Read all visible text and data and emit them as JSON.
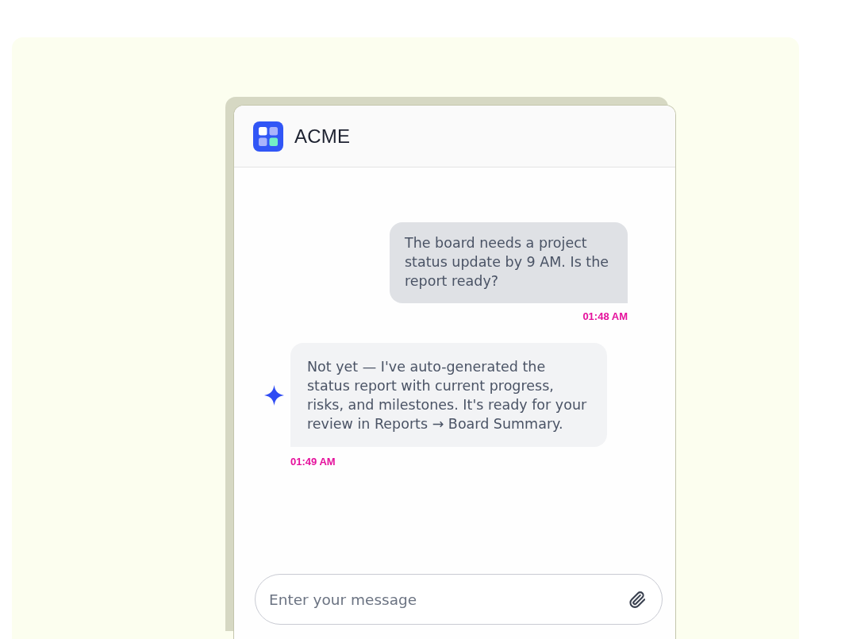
{
  "app": {
    "name": "ACME"
  },
  "messages": [
    {
      "kind": "user",
      "text": "The board needs a project status update by 9 AM. Is the report ready?",
      "time": "01:48 AM"
    },
    {
      "kind": "assistant",
      "text": "Not yet — I've auto-generated the status report with current progress, risks, and milestones. It's ready for your review in Reports → Board Summary.",
      "time": "01:49 AM"
    }
  ],
  "composer": {
    "placeholder": "Enter your message"
  }
}
